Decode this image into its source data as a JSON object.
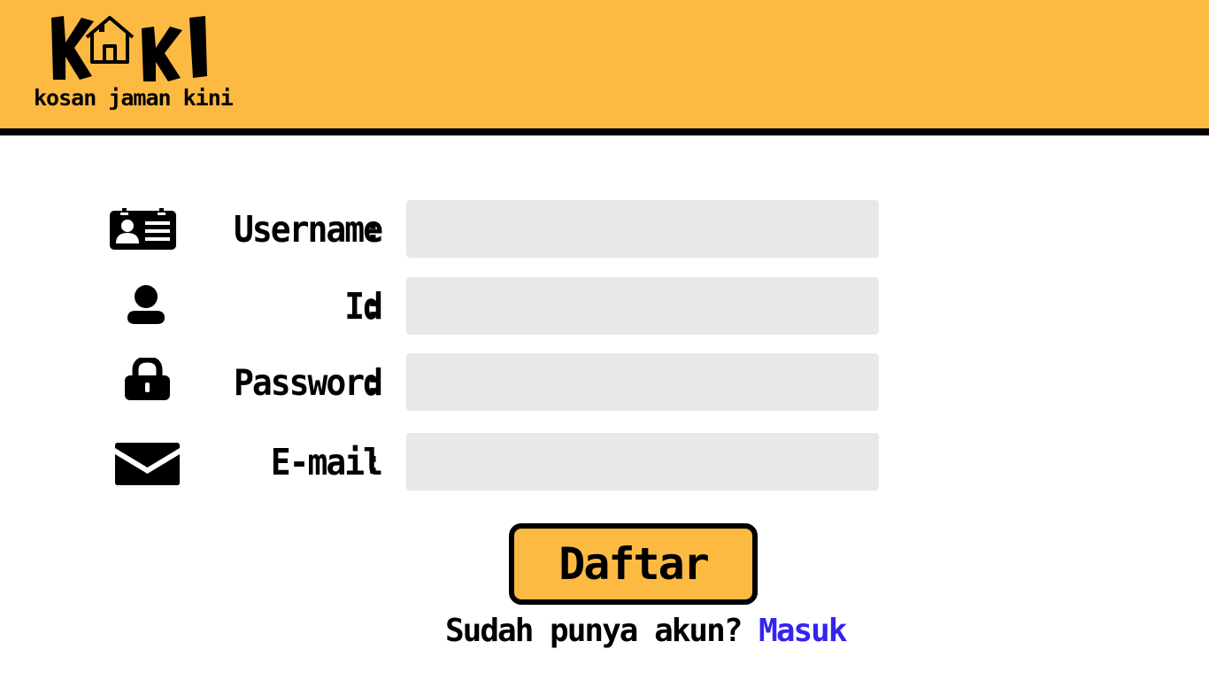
{
  "brand": {
    "logo_text": "KOKI",
    "tagline": "kosan jaman kini",
    "header_color": "#FDBA43"
  },
  "form": {
    "fields": [
      {
        "label": "Username",
        "colon": ":",
        "icon": "id-card-icon",
        "value": "",
        "placeholder": ""
      },
      {
        "label": "Id",
        "colon": ":",
        "icon": "user-icon",
        "value": "",
        "placeholder": ""
      },
      {
        "label": "Password",
        "colon": ":",
        "icon": "lock-icon",
        "value": "",
        "placeholder": ""
      },
      {
        "label": "E-mail",
        "colon": ":",
        "icon": "envelope-icon",
        "value": "",
        "placeholder": ""
      }
    ],
    "submit_label": "Daftar"
  },
  "footer": {
    "prompt": "Sudah punya akun? ",
    "login_link": "Masuk",
    "link_color": "#3324F0"
  }
}
